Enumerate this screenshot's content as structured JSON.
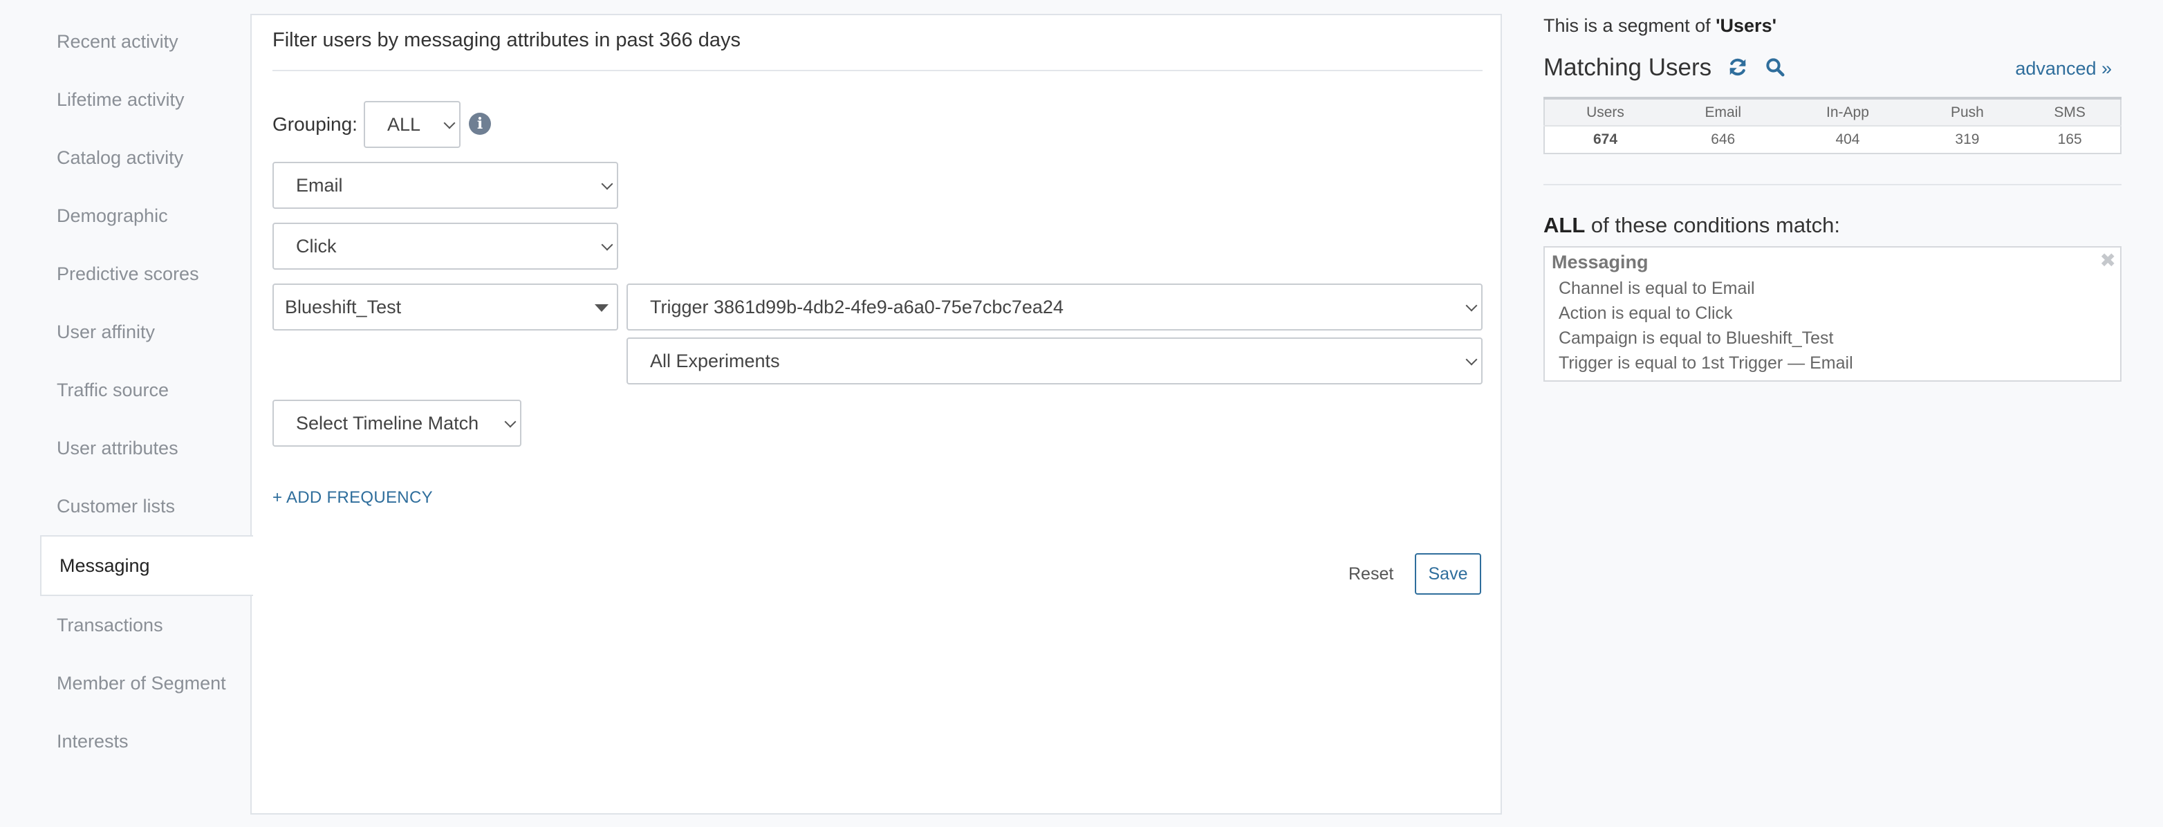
{
  "sidebar": {
    "items": [
      {
        "label": "Recent activity"
      },
      {
        "label": "Lifetime activity"
      },
      {
        "label": "Catalog activity"
      },
      {
        "label": "Demographic"
      },
      {
        "label": "Predictive scores"
      },
      {
        "label": "User affinity"
      },
      {
        "label": "Traffic source"
      },
      {
        "label": "User attributes"
      },
      {
        "label": "Customer lists"
      },
      {
        "label": "Messaging",
        "active": true
      },
      {
        "label": "Transactions"
      },
      {
        "label": "Member of Segment"
      },
      {
        "label": "Interests"
      }
    ]
  },
  "main": {
    "title": "Filter users by messaging attributes in past 366 days",
    "grouping_label": "Grouping:",
    "grouping_value": "ALL",
    "channel_value": "Email",
    "action_value": "Click",
    "campaign_value": "Blueshift_Test",
    "trigger_value": "Trigger 3861d99b-4db2-4fe9-a6a0-75e7cbc7ea24",
    "experiment_value": "All Experiments",
    "timeline_value": "Select Timeline Match",
    "add_frequency": "+ ADD FREQUENCY",
    "reset_label": "Reset",
    "save_label": "Save",
    "info_icon": "i"
  },
  "right": {
    "segment_prefix": "This is a segment of ",
    "segment_name": "'Users'",
    "matching_title": "Matching Users",
    "advanced_link": "advanced »",
    "table": {
      "headers": [
        "Users",
        "Email",
        "In-App",
        "Push",
        "SMS"
      ],
      "values": [
        "674",
        "646",
        "404",
        "319",
        "165"
      ]
    },
    "conditions_prefix": "ALL",
    "conditions_suffix": " of these conditions match:",
    "condition_group": "Messaging",
    "conditions": [
      "Channel is equal to Email",
      "Action is equal to Click",
      "Campaign is equal to Blueshift_Test",
      "Trigger is equal to 1st Trigger — Email"
    ],
    "close_glyph": "✖"
  },
  "colors": {
    "accent": "#2f6e9c",
    "icon": "#6f7f93",
    "border": "#dfe3e8"
  }
}
